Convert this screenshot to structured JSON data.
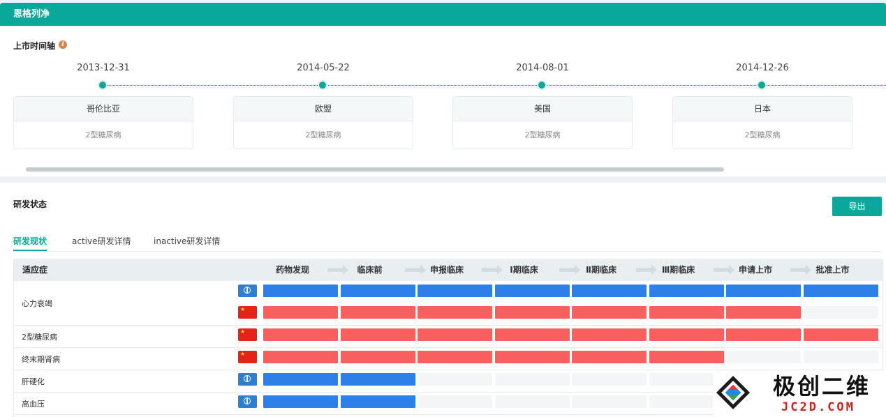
{
  "header": {
    "title": "恩格列净"
  },
  "timeline": {
    "title": "上市时间轴",
    "info_icon": "info-icon",
    "items": [
      {
        "date": "2013-12-31",
        "country": "哥伦比亚",
        "indication": "2型糖尿病"
      },
      {
        "date": "2014-05-22",
        "country": "欧盟",
        "indication": "2型糖尿病"
      },
      {
        "date": "2014-08-01",
        "country": "美国",
        "indication": "2型糖尿病"
      },
      {
        "date": "2014-12-26",
        "country": "日本",
        "indication": "2型糖尿病"
      }
    ]
  },
  "rd": {
    "title": "研发状态",
    "export_label": "导出",
    "tabs": [
      "研发现状",
      "active研发详情",
      "inactive研发详情"
    ],
    "table": {
      "indication_header": "适应症",
      "stages": [
        "药物发现",
        "临床前",
        "申报临床",
        "Ⅰ期临床",
        "Ⅱ期临床",
        "Ⅲ期临床",
        "申请上市",
        "批准上市"
      ],
      "rows": [
        {
          "label": "心力衰竭",
          "lines": [
            {
              "region": "globe-icon",
              "color": "#2f7fe8",
              "stages_filled": 8
            },
            {
              "region": "china-flag-icon",
              "color": "#f86060",
              "stages_filled": 7
            }
          ]
        },
        {
          "label": "2型糖尿病",
          "lines": [
            {
              "region": "china-flag-icon",
              "color": "#f86060",
              "stages_filled": 8
            }
          ]
        },
        {
          "label": "终末期肾病",
          "lines": [
            {
              "region": "china-flag-icon",
              "color": "#f86060",
              "stages_filled": 6
            }
          ]
        },
        {
          "label": "肝硬化",
          "lines": [
            {
              "region": "globe-icon",
              "color": "#2f7fe8",
              "stages_filled": 2
            }
          ]
        },
        {
          "label": "高血压",
          "lines": [
            {
              "region": "globe-icon",
              "color": "#2f7fe8",
              "stages_filled": 2
            }
          ]
        }
      ]
    }
  },
  "watermark": {
    "name_cn": "极创二维",
    "name_en": "JC2D.COM"
  },
  "colors": {
    "accent": "#0aa89a",
    "blue": "#2f7fe8",
    "red": "#f86060"
  }
}
